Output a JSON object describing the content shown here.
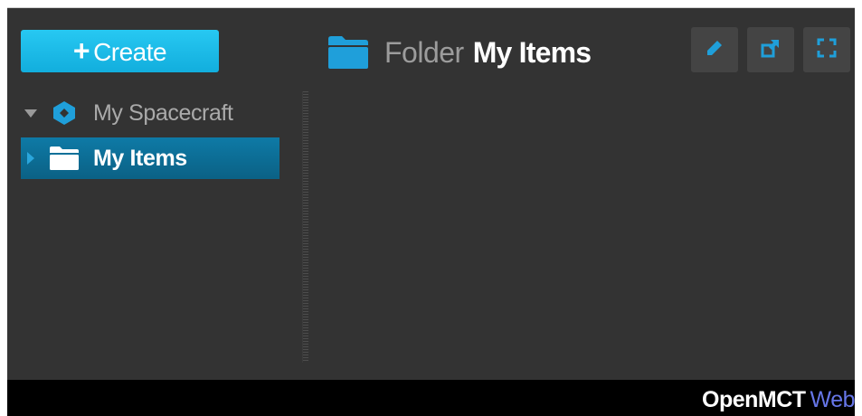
{
  "toolbar": {
    "create_label": "Create",
    "create_plus": "+"
  },
  "tree": {
    "items": [
      {
        "label": "My Spacecraft",
        "icon": "spacecraft-icon",
        "expanded": true,
        "selected": false
      },
      {
        "label": "My Items",
        "icon": "folder-icon",
        "expanded": false,
        "selected": true
      }
    ]
  },
  "header": {
    "type_label": "Folder",
    "title": "My Items",
    "icon": "folder-icon"
  },
  "actions": [
    {
      "name": "edit",
      "icon": "pencil-icon"
    },
    {
      "name": "open-new-window",
      "icon": "new-window-icon"
    },
    {
      "name": "fullscreen",
      "icon": "fullscreen-icon"
    }
  ],
  "footer": {
    "logo_primary": "OpenMCT",
    "logo_secondary": "Web"
  },
  "colors": {
    "accent": "#1cbfe8",
    "selected": "#0c6e97",
    "background": "#333333",
    "button_bg": "#444444",
    "icon_blue": "#1f9fda",
    "logo_web": "#6676e8"
  }
}
